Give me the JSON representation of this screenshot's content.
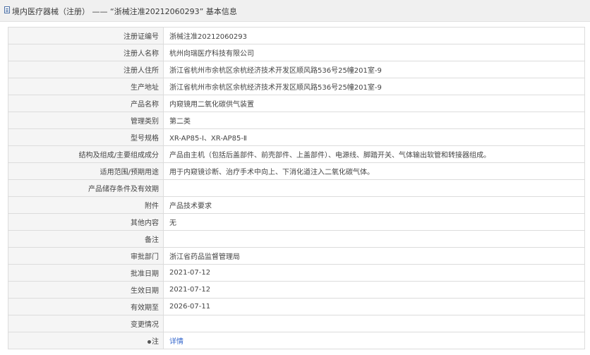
{
  "header": {
    "title": "境内医疗器械（注册） —— “浙械注准20212060293” 基本信息"
  },
  "rows": [
    {
      "label": "注册证编号",
      "value": "浙械注准20212060293"
    },
    {
      "label": "注册人名称",
      "value": "杭州向瑞医疗科技有限公司"
    },
    {
      "label": "注册人住所",
      "value": "浙江省杭州市余杭区余杭经济技术开发区顺风路536号25幢201室-9"
    },
    {
      "label": "生产地址",
      "value": "浙江省杭州市余杭区余杭经济技术开发区顺风路536号25幢201室-9"
    },
    {
      "label": "产品名称",
      "value": "内窥镜用二氧化碳供气装置"
    },
    {
      "label": "管理类别",
      "value": "第二类"
    },
    {
      "label": "型号规格",
      "value": "XR-AP85-Ⅰ、XR-AP85-Ⅱ"
    },
    {
      "label": "结构及组成/主要组成成分",
      "value": "产品由主机（包括后盖部件、前壳部件、上盖部件）、电源线、脚踏开关、气体输出软管和转接器组成。"
    },
    {
      "label": "适用范围/预期用途",
      "value": "用于内窥镜诊断、治疗手术中向上、下消化道注入二氧化碳气体。"
    },
    {
      "label": "产品储存条件及有效期",
      "value": ""
    },
    {
      "label": "附件",
      "value": "产品技术要求"
    },
    {
      "label": "其他内容",
      "value": "无"
    },
    {
      "label": "备注",
      "value": ""
    },
    {
      "label": "审批部门",
      "value": "浙江省药品监督管理局"
    },
    {
      "label": "批准日期",
      "value": "2021-07-12"
    },
    {
      "label": "生效日期",
      "value": "2021-07-12"
    },
    {
      "label": "有效期至",
      "value": "2026-07-11"
    },
    {
      "label": "变更情况",
      "value": ""
    }
  ],
  "note": {
    "label": "注",
    "link_text": "详情"
  },
  "colors": {
    "link": "#3366cc",
    "label_bg": "#f5f5f5",
    "border": "#dcdcdc"
  }
}
